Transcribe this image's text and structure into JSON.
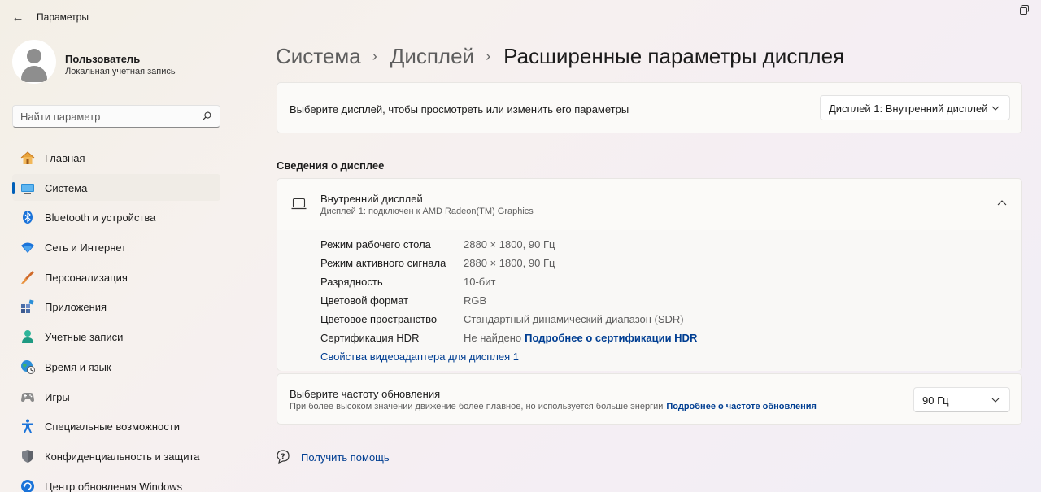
{
  "window": {
    "title": "Параметры"
  },
  "profile": {
    "name": "Пользователь",
    "account_type": "Локальная учетная запись"
  },
  "search": {
    "placeholder": "Найти параметр",
    "icon": "search-icon"
  },
  "sidebar": {
    "items": [
      {
        "label": "Главная",
        "icon": "home-icon",
        "active": false
      },
      {
        "label": "Система",
        "icon": "system-display-icon",
        "active": true
      },
      {
        "label": "Bluetooth и устройства",
        "icon": "bluetooth-icon",
        "active": false
      },
      {
        "label": "Сеть и Интернет",
        "icon": "wifi-icon",
        "active": false
      },
      {
        "label": "Персонализация",
        "icon": "brush-icon",
        "active": false
      },
      {
        "label": "Приложения",
        "icon": "apps-icon",
        "active": false
      },
      {
        "label": "Учетные записи",
        "icon": "account-icon",
        "active": false
      },
      {
        "label": "Время и язык",
        "icon": "globe-clock-icon",
        "active": false
      },
      {
        "label": "Игры",
        "icon": "gamepad-icon",
        "active": false
      },
      {
        "label": "Специальные возможности",
        "icon": "accessibility-icon",
        "active": false
      },
      {
        "label": "Конфиденциальность и защита",
        "icon": "shield-icon",
        "active": false
      },
      {
        "label": "Центр обновления Windows",
        "icon": "windows-update-icon",
        "active": false
      }
    ],
    "accent_color": "#005fb8"
  },
  "breadcrumb": {
    "items": [
      "Система",
      "Дисплей",
      "Расширенные параметры дисплея"
    ]
  },
  "display_select": {
    "label": "Выберите дисплей, чтобы просмотреть или изменить его параметры",
    "selected": "Дисплей 1: Внутренний дисплей"
  },
  "display_info": {
    "section_title": "Сведения о дисплее",
    "name": "Внутренний дисплей",
    "connection": "Дисплей 1: подключен к AMD Radeon(TM) Graphics",
    "properties": [
      {
        "key": "Режим рабочего стола",
        "value": "2880 × 1800, 90 Гц"
      },
      {
        "key": "Режим активного сигнала",
        "value": "2880 × 1800, 90 Гц"
      },
      {
        "key": "Разрядность",
        "value": "10-бит"
      },
      {
        "key": "Цветовой формат",
        "value": "RGB"
      },
      {
        "key": "Цветовое пространство",
        "value": "Стандартный динамический диапазон (SDR)"
      },
      {
        "key": "Сертификация HDR",
        "value": "Не найдено",
        "link": "Подробнее о сертификации HDR"
      }
    ],
    "adapter_link": "Свойства видеоадаптера для дисплея 1"
  },
  "refresh_rate": {
    "title": "Выберите частоту обновления",
    "description": "При более высоком значении движение более плавное, но используется больше энергии",
    "link": "Подробнее о частоте обновления",
    "selected": "90 Гц"
  },
  "help": {
    "label": "Получить помощь"
  },
  "colors": {
    "link": "#003e92",
    "accent": "#005fb8"
  }
}
